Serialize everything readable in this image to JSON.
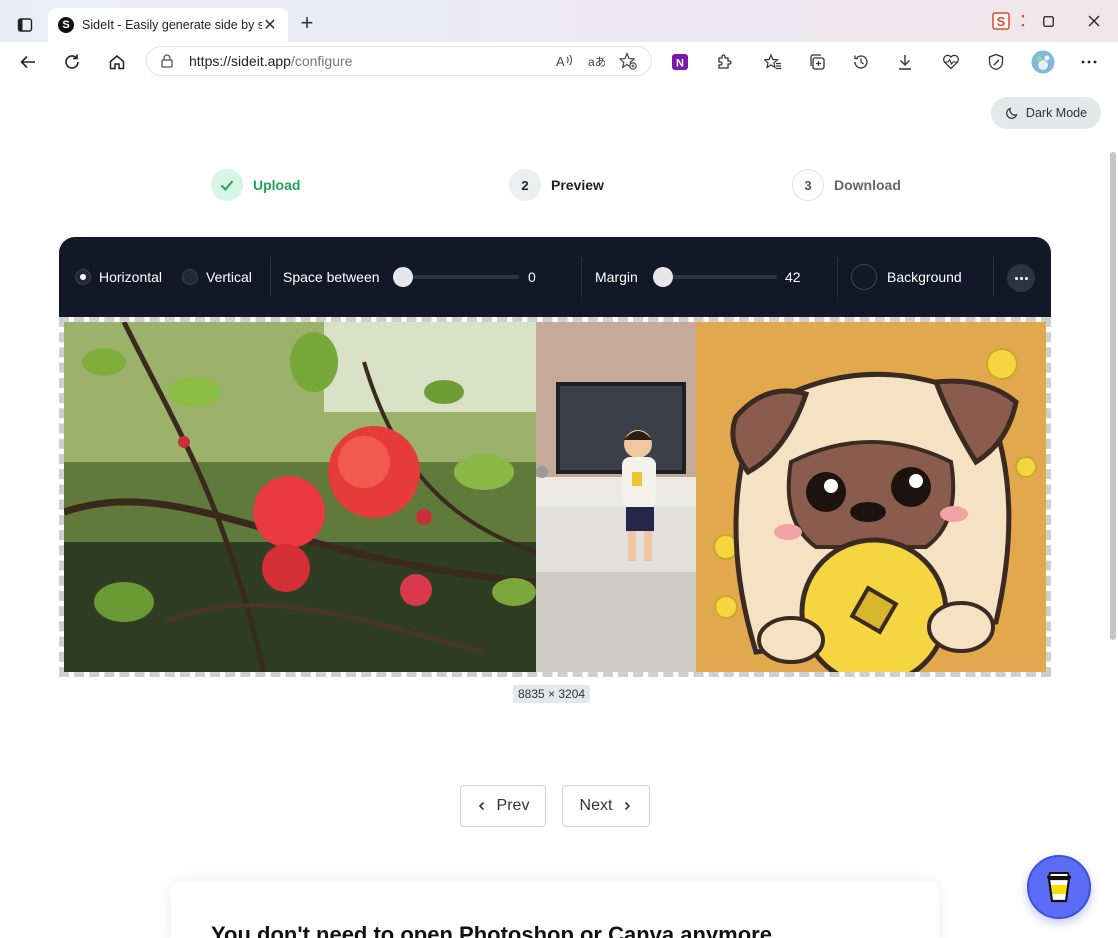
{
  "browser": {
    "tab_title": "SideIt - Easily generate side by side",
    "tab_favicon_letter": "S",
    "url_host": "https://sideit.app",
    "url_path": "/configure"
  },
  "page": {
    "dark_mode_label": "Dark Mode",
    "steps": [
      {
        "number": "✓",
        "label": "Upload",
        "state": "done"
      },
      {
        "number": "2",
        "label": "Preview",
        "state": "current"
      },
      {
        "number": "3",
        "label": "Download",
        "state": "upcoming"
      }
    ],
    "editor": {
      "layout_options": [
        {
          "label": "Horizontal",
          "selected": true
        },
        {
          "label": "Vertical",
          "selected": false
        }
      ],
      "space_between": {
        "label": "Space between",
        "value": "0",
        "fraction": 0
      },
      "margin": {
        "label": "Margin",
        "value": "42",
        "fraction": 0
      },
      "background_label": "Background",
      "background_color": "#111827"
    },
    "images": [
      {
        "name": "red flowering quince branch"
      },
      {
        "name": "toddler in living room"
      },
      {
        "name": "cartoon pug holding gold coin"
      }
    ],
    "output_dimensions": "8835 × 3204",
    "prev_label": "Prev",
    "next_label": "Next",
    "headline": "You don't need to open Photoshop or Canva anymore"
  },
  "colors": {
    "accent_green": "#22a35a",
    "editor_bg": "#111827",
    "coffee_button": "#5b6cf5"
  }
}
